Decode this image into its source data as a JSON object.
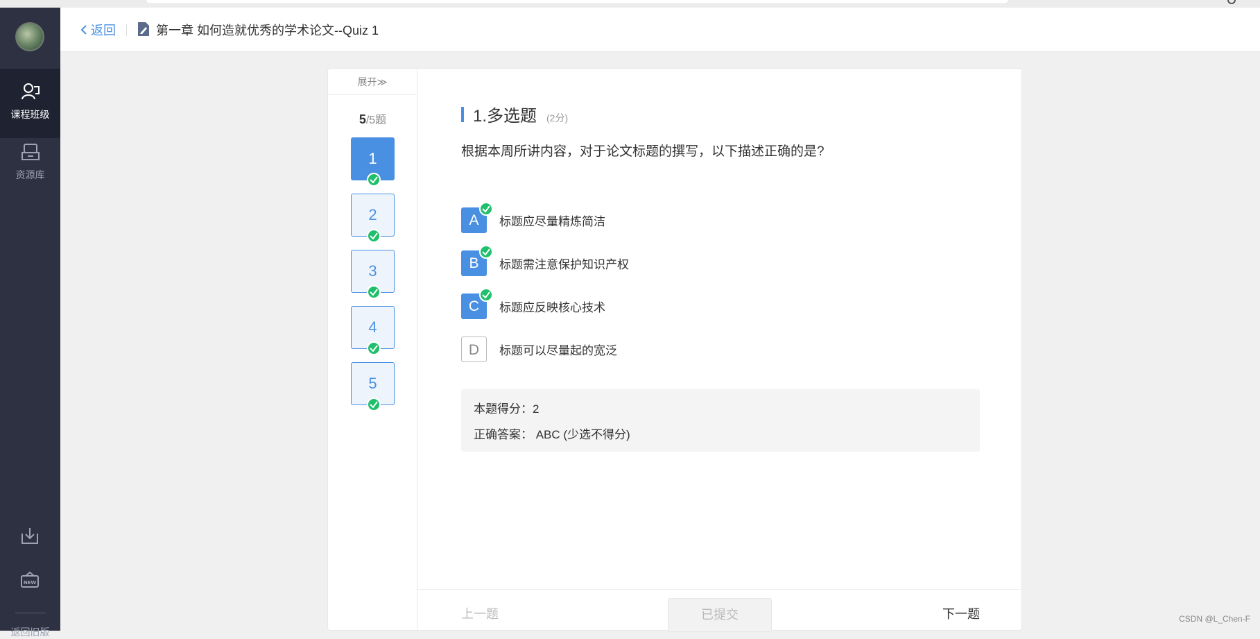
{
  "sidebar": {
    "items": [
      {
        "label": "课程班级",
        "icon": "class-icon"
      },
      {
        "label": "资源库",
        "icon": "library-icon"
      }
    ],
    "bottom_icons": [
      "download-icon",
      "new-icon"
    ],
    "footer_label": "返回旧版"
  },
  "header": {
    "back_label": "返回",
    "title": "第一章 如何造就优秀的学术论文--Quiz 1"
  },
  "qnav": {
    "expand_label": "展开≫",
    "current": "5",
    "total_suffix": "/5题",
    "questions": [
      "1",
      "2",
      "3",
      "4",
      "5"
    ]
  },
  "question": {
    "type": "1.多选题",
    "score": "(2分)",
    "text": "根据本周所讲内容，对于论文标题的撰写，以下描述正确的是?",
    "options": [
      {
        "letter": "A",
        "text": "标题应尽量精炼简洁",
        "selected": true
      },
      {
        "letter": "B",
        "text": "标题需注意保护知识产权",
        "selected": true
      },
      {
        "letter": "C",
        "text": "标题应反映核心技术",
        "selected": true
      },
      {
        "letter": "D",
        "text": "标题可以尽量起的宽泛",
        "selected": false
      }
    ]
  },
  "result": {
    "score_line": "本题得分：2",
    "answer_line": "正确答案：  ABC (少选不得分)"
  },
  "footer": {
    "prev_label": "上一题",
    "submitted_label": "已提交",
    "next_label": "下一题"
  },
  "watermark": "CSDN @L_Chen-F",
  "colors": {
    "accent": "#4a90e2",
    "check": "#1fbf6b",
    "sidebar": "#2d3142"
  }
}
